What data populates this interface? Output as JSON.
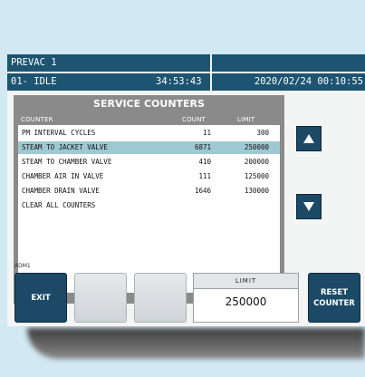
{
  "header": {
    "device_name": "PREVAC 1",
    "cycle_status": "01- IDLE",
    "elapsed_time": "34:53:43",
    "datetime": "2020/02/24 00:10:55"
  },
  "panel": {
    "title": "SERVICE COUNTERS",
    "columns": {
      "counter": "COUNTER",
      "count": "COUNT",
      "limit": "LIMIT"
    },
    "rows": [
      {
        "name": "PM INTERVAL CYCLES",
        "count": "11",
        "limit": "300",
        "selected": false
      },
      {
        "name": "STEAM TO JACKET VALVE",
        "count": "6871",
        "limit": "250000",
        "selected": true
      },
      {
        "name": "STEAM TO CHAMBER VALVE",
        "count": "410",
        "limit": "200000",
        "selected": false
      },
      {
        "name": "CHAMBER AIR IN VALVE",
        "count": "111",
        "limit": "125000",
        "selected": false
      },
      {
        "name": "CHAMBER DRAIN VALVE",
        "count": "1646",
        "limit": "130000",
        "selected": false
      },
      {
        "name": "CLEAR ALL COUNTERS",
        "count": "",
        "limit": "",
        "selected": false
      }
    ]
  },
  "icons": {
    "up": "triangle-up-icon",
    "down": "triangle-down-icon"
  },
  "footer": {
    "user": "ADM1",
    "exit_label": "EXIT",
    "limit_label": "LIMIT",
    "limit_value": "250000",
    "reset_label_line1": "RESET",
    "reset_label_line2": "COUNTER"
  },
  "colors": {
    "header_bg": "#1c5471",
    "button_bg": "#1c4a66",
    "selected_row": "#9ec8d2",
    "panel_bg": "#8a8a8a"
  }
}
